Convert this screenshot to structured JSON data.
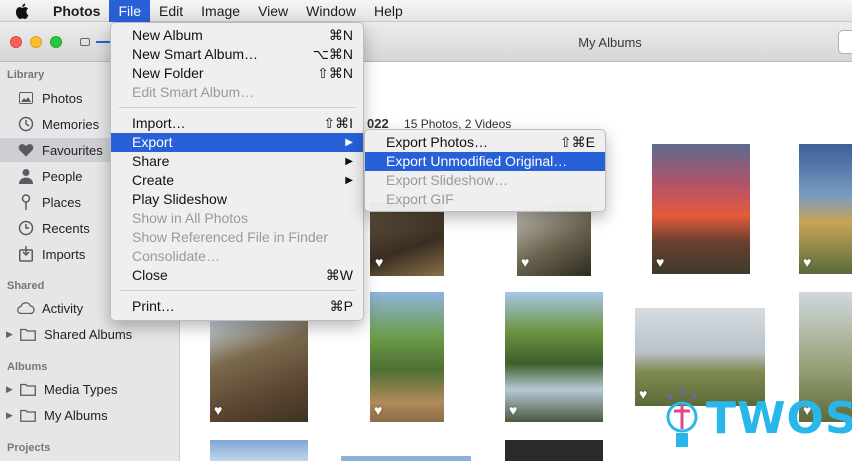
{
  "menubar": {
    "apple_icon": "apple-logo-icon",
    "items": [
      "Photos",
      "File",
      "Edit",
      "Image",
      "View",
      "Window",
      "Help"
    ]
  },
  "window": {
    "title": "My Albums"
  },
  "sidebar": {
    "sections": {
      "library": "Library",
      "shared": "Shared",
      "albums": "Albums",
      "projects": "Projects"
    },
    "library_items": [
      {
        "label": "Photos",
        "icon": "photos-icon"
      },
      {
        "label": "Memories",
        "icon": "memories-icon"
      },
      {
        "label": "Favourites",
        "icon": "heart-icon"
      },
      {
        "label": "People",
        "icon": "person-icon"
      },
      {
        "label": "Places",
        "icon": "pin-icon"
      },
      {
        "label": "Recents",
        "icon": "clock-icon"
      },
      {
        "label": "Imports",
        "icon": "import-icon"
      }
    ],
    "shared_items": [
      {
        "label": "Activity",
        "icon": "cloud-icon"
      },
      {
        "label": "Shared Albums",
        "icon": "folder-icon"
      }
    ],
    "album_items": [
      {
        "label": "Media Types",
        "icon": "folder-icon"
      },
      {
        "label": "My Albums",
        "icon": "folder-icon"
      }
    ]
  },
  "album_header": {
    "year_fragment": "022",
    "count": "15 Photos, 2 Videos"
  },
  "file_menu": {
    "items": [
      {
        "label": "New Album",
        "shortcut": "⌘N",
        "disabled": false
      },
      {
        "label": "New Smart Album…",
        "shortcut": "⌥⌘N",
        "disabled": false
      },
      {
        "label": "New Folder",
        "shortcut": "⇧⌘N",
        "disabled": false
      },
      {
        "label": "Edit Smart Album…",
        "shortcut": "",
        "disabled": true
      },
      {
        "label": "Import…",
        "shortcut": "⇧⌘I",
        "disabled": false
      },
      {
        "label": "Export",
        "shortcut": "▶",
        "disabled": false
      },
      {
        "label": "Share",
        "shortcut": "▶",
        "disabled": false
      },
      {
        "label": "Create",
        "shortcut": "▶",
        "disabled": false
      },
      {
        "label": "Play Slideshow",
        "shortcut": "",
        "disabled": false
      },
      {
        "label": "Show in All Photos",
        "shortcut": "",
        "disabled": true
      },
      {
        "label": "Show Referenced File in Finder",
        "shortcut": "",
        "disabled": true
      },
      {
        "label": "Consolidate…",
        "shortcut": "",
        "disabled": true
      },
      {
        "label": "Close",
        "shortcut": "⌘W",
        "disabled": false
      },
      {
        "label": "Print…",
        "shortcut": "⌘P",
        "disabled": false
      }
    ]
  },
  "export_menu": {
    "items": [
      {
        "label": "Export Photos…",
        "shortcut": "⇧⌘E",
        "disabled": false
      },
      {
        "label": "Export Unmodified Original…",
        "shortcut": "",
        "disabled": false
      },
      {
        "label": "Export Slideshow…",
        "shortcut": "",
        "disabled": true
      },
      {
        "label": "Export GIF",
        "shortcut": "",
        "disabled": true
      }
    ]
  },
  "watermark": {
    "text": "TWOS",
    "logo": "twos-logo-icon"
  },
  "colors": {
    "accent": "#2860d8",
    "sidebar_bg": "#e6e6e8",
    "watermark": "#29b6e8"
  }
}
